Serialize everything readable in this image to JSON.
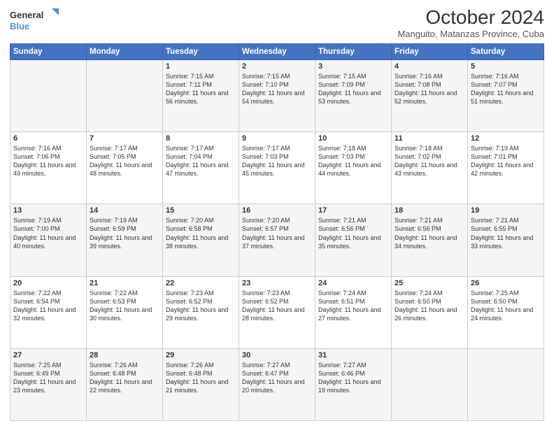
{
  "logo": {
    "line1": "General",
    "line2": "Blue"
  },
  "title": {
    "month_year": "October 2024",
    "location": "Manguito, Matanzas Province, Cuba"
  },
  "days_of_week": [
    "Sunday",
    "Monday",
    "Tuesday",
    "Wednesday",
    "Thursday",
    "Friday",
    "Saturday"
  ],
  "weeks": [
    [
      {
        "day": "",
        "sunrise": "",
        "sunset": "",
        "daylight": ""
      },
      {
        "day": "",
        "sunrise": "",
        "sunset": "",
        "daylight": ""
      },
      {
        "day": "1",
        "sunrise": "Sunrise: 7:15 AM",
        "sunset": "Sunset: 7:11 PM",
        "daylight": "Daylight: 11 hours and 56 minutes."
      },
      {
        "day": "2",
        "sunrise": "Sunrise: 7:15 AM",
        "sunset": "Sunset: 7:10 PM",
        "daylight": "Daylight: 11 hours and 54 minutes."
      },
      {
        "day": "3",
        "sunrise": "Sunrise: 7:15 AM",
        "sunset": "Sunset: 7:09 PM",
        "daylight": "Daylight: 11 hours and 53 minutes."
      },
      {
        "day": "4",
        "sunrise": "Sunrise: 7:16 AM",
        "sunset": "Sunset: 7:08 PM",
        "daylight": "Daylight: 11 hours and 52 minutes."
      },
      {
        "day": "5",
        "sunrise": "Sunrise: 7:16 AM",
        "sunset": "Sunset: 7:07 PM",
        "daylight": "Daylight: 11 hours and 51 minutes."
      }
    ],
    [
      {
        "day": "6",
        "sunrise": "Sunrise: 7:16 AM",
        "sunset": "Sunset: 7:06 PM",
        "daylight": "Daylight: 11 hours and 49 minutes."
      },
      {
        "day": "7",
        "sunrise": "Sunrise: 7:17 AM",
        "sunset": "Sunset: 7:05 PM",
        "daylight": "Daylight: 11 hours and 48 minutes."
      },
      {
        "day": "8",
        "sunrise": "Sunrise: 7:17 AM",
        "sunset": "Sunset: 7:04 PM",
        "daylight": "Daylight: 11 hours and 47 minutes."
      },
      {
        "day": "9",
        "sunrise": "Sunrise: 7:17 AM",
        "sunset": "Sunset: 7:03 PM",
        "daylight": "Daylight: 11 hours and 45 minutes."
      },
      {
        "day": "10",
        "sunrise": "Sunrise: 7:18 AM",
        "sunset": "Sunset: 7:03 PM",
        "daylight": "Daylight: 11 hours and 44 minutes."
      },
      {
        "day": "11",
        "sunrise": "Sunrise: 7:18 AM",
        "sunset": "Sunset: 7:02 PM",
        "daylight": "Daylight: 11 hours and 43 minutes."
      },
      {
        "day": "12",
        "sunrise": "Sunrise: 7:19 AM",
        "sunset": "Sunset: 7:01 PM",
        "daylight": "Daylight: 11 hours and 42 minutes."
      }
    ],
    [
      {
        "day": "13",
        "sunrise": "Sunrise: 7:19 AM",
        "sunset": "Sunset: 7:00 PM",
        "daylight": "Daylight: 11 hours and 40 minutes."
      },
      {
        "day": "14",
        "sunrise": "Sunrise: 7:19 AM",
        "sunset": "Sunset: 6:59 PM",
        "daylight": "Daylight: 11 hours and 39 minutes."
      },
      {
        "day": "15",
        "sunrise": "Sunrise: 7:20 AM",
        "sunset": "Sunset: 6:58 PM",
        "daylight": "Daylight: 11 hours and 38 minutes."
      },
      {
        "day": "16",
        "sunrise": "Sunrise: 7:20 AM",
        "sunset": "Sunset: 6:57 PM",
        "daylight": "Daylight: 11 hours and 37 minutes."
      },
      {
        "day": "17",
        "sunrise": "Sunrise: 7:21 AM",
        "sunset": "Sunset: 6:56 PM",
        "daylight": "Daylight: 11 hours and 35 minutes."
      },
      {
        "day": "18",
        "sunrise": "Sunrise: 7:21 AM",
        "sunset": "Sunset: 6:56 PM",
        "daylight": "Daylight: 11 hours and 34 minutes."
      },
      {
        "day": "19",
        "sunrise": "Sunrise: 7:21 AM",
        "sunset": "Sunset: 6:55 PM",
        "daylight": "Daylight: 11 hours and 33 minutes."
      }
    ],
    [
      {
        "day": "20",
        "sunrise": "Sunrise: 7:22 AM",
        "sunset": "Sunset: 6:54 PM",
        "daylight": "Daylight: 11 hours and 32 minutes."
      },
      {
        "day": "21",
        "sunrise": "Sunrise: 7:22 AM",
        "sunset": "Sunset: 6:53 PM",
        "daylight": "Daylight: 11 hours and 30 minutes."
      },
      {
        "day": "22",
        "sunrise": "Sunrise: 7:23 AM",
        "sunset": "Sunset: 6:52 PM",
        "daylight": "Daylight: 11 hours and 29 minutes."
      },
      {
        "day": "23",
        "sunrise": "Sunrise: 7:23 AM",
        "sunset": "Sunset: 6:52 PM",
        "daylight": "Daylight: 11 hours and 28 minutes."
      },
      {
        "day": "24",
        "sunrise": "Sunrise: 7:24 AM",
        "sunset": "Sunset: 6:51 PM",
        "daylight": "Daylight: 11 hours and 27 minutes."
      },
      {
        "day": "25",
        "sunrise": "Sunrise: 7:24 AM",
        "sunset": "Sunset: 6:50 PM",
        "daylight": "Daylight: 11 hours and 26 minutes."
      },
      {
        "day": "26",
        "sunrise": "Sunrise: 7:25 AM",
        "sunset": "Sunset: 6:50 PM",
        "daylight": "Daylight: 11 hours and 24 minutes."
      }
    ],
    [
      {
        "day": "27",
        "sunrise": "Sunrise: 7:25 AM",
        "sunset": "Sunset: 6:49 PM",
        "daylight": "Daylight: 11 hours and 23 minutes."
      },
      {
        "day": "28",
        "sunrise": "Sunrise: 7:26 AM",
        "sunset": "Sunset: 6:48 PM",
        "daylight": "Daylight: 11 hours and 22 minutes."
      },
      {
        "day": "29",
        "sunrise": "Sunrise: 7:26 AM",
        "sunset": "Sunset: 6:48 PM",
        "daylight": "Daylight: 11 hours and 21 minutes."
      },
      {
        "day": "30",
        "sunrise": "Sunrise: 7:27 AM",
        "sunset": "Sunset: 6:47 PM",
        "daylight": "Daylight: 11 hours and 20 minutes."
      },
      {
        "day": "31",
        "sunrise": "Sunrise: 7:27 AM",
        "sunset": "Sunset: 6:46 PM",
        "daylight": "Daylight: 11 hours and 19 minutes."
      },
      {
        "day": "",
        "sunrise": "",
        "sunset": "",
        "daylight": ""
      },
      {
        "day": "",
        "sunrise": "",
        "sunset": "",
        "daylight": ""
      }
    ]
  ]
}
